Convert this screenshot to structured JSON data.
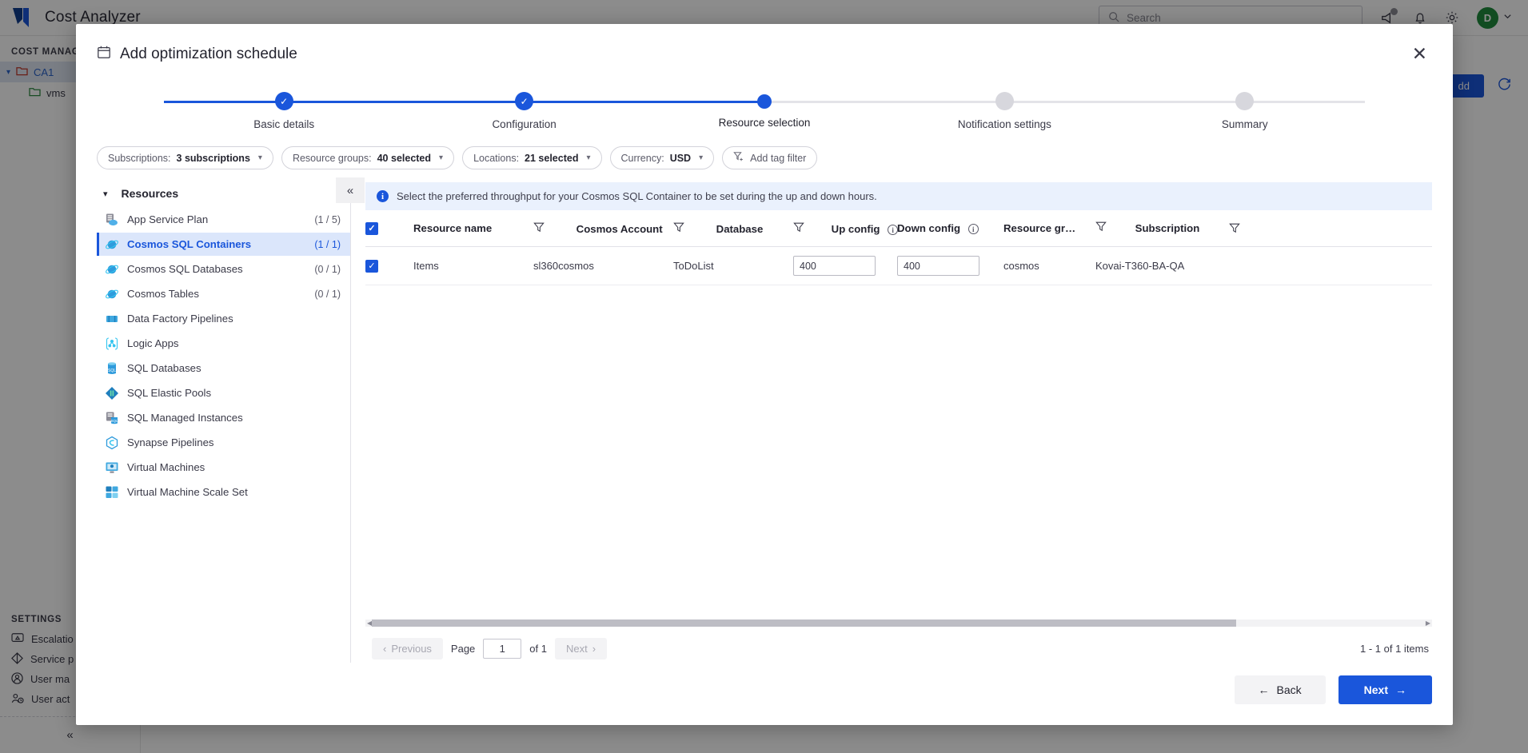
{
  "app": {
    "title": "Cost Analyzer",
    "logo_icon": "azure-logo-icon",
    "search_placeholder": "Search",
    "icons": {
      "search": "search-icon",
      "announcement": "megaphone-icon",
      "notifications": "bell-icon",
      "settings": "gear-icon",
      "avatar_initial": "D",
      "avatar_chevron": "chevron-down-icon"
    },
    "accent_color": "#1a56db",
    "avatar_color": "#1f8a3c"
  },
  "left_nav": {
    "section_title": "COST MANAGE",
    "tree": [
      {
        "label": "CA1",
        "selected": true,
        "folder_color": "#c03a2b",
        "expanded": true
      },
      {
        "label": "vms",
        "selected": false,
        "folder_color": "#2f8a43",
        "child": true
      }
    ],
    "settings_title": "SETTINGS",
    "settings_items": [
      {
        "label": "Escalatio",
        "icon": "escalation-icon"
      },
      {
        "label": "Service p",
        "icon": "diamond-icon"
      },
      {
        "label": "User ma",
        "icon": "user-circle-icon"
      },
      {
        "label": "User act",
        "icon": "user-activity-icon"
      }
    ],
    "collapse_icon": "chevron-double-left-icon"
  },
  "background_page": {
    "add_button": "dd",
    "refresh_icon": "refresh-icon"
  },
  "modal": {
    "title": "Add optimization schedule",
    "title_icon": "calendar-icon",
    "close_icon": "close-icon",
    "stepper": {
      "steps": [
        {
          "label": "Basic details",
          "state": "done"
        },
        {
          "label": "Configuration",
          "state": "done"
        },
        {
          "label": "Resource selection",
          "state": "active"
        },
        {
          "label": "Notification settings",
          "state": "pending"
        },
        {
          "label": "Summary",
          "state": "pending"
        }
      ]
    },
    "filters": [
      {
        "name": "subscriptions",
        "label": "Subscriptions:",
        "value": "3 subscriptions",
        "has_chevron": true
      },
      {
        "name": "resource-groups",
        "label": "Resource groups:",
        "value": "40 selected",
        "has_chevron": true
      },
      {
        "name": "locations",
        "label": "Locations:",
        "value": "21 selected",
        "has_chevron": true
      },
      {
        "name": "currency",
        "label": "Currency:",
        "value": "USD",
        "has_chevron": true
      },
      {
        "name": "add-tag-filter",
        "label": "",
        "value": "Add tag filter",
        "has_chevron": false,
        "icon": "filter-plus-icon"
      }
    ],
    "resources_panel": {
      "header": "Resources",
      "collapse_icon": "chevron-double-left-icon",
      "items": [
        {
          "label": "App Service Plan",
          "count": "(1 / 5)",
          "icon": "app-service-plan-icon",
          "selected": false
        },
        {
          "label": "Cosmos SQL Containers",
          "count": "(1 / 1)",
          "icon": "cosmos-db-icon",
          "selected": true
        },
        {
          "label": "Cosmos SQL Databases",
          "count": "(0 / 1)",
          "icon": "cosmos-db-icon",
          "selected": false
        },
        {
          "label": "Cosmos Tables",
          "count": "(0 / 1)",
          "icon": "cosmos-db-icon",
          "selected": false
        },
        {
          "label": "Data Factory Pipelines",
          "count": "",
          "icon": "data-factory-icon",
          "selected": false
        },
        {
          "label": "Logic Apps",
          "count": "",
          "icon": "logic-apps-icon",
          "selected": false
        },
        {
          "label": "SQL Databases",
          "count": "",
          "icon": "sql-database-icon",
          "selected": false
        },
        {
          "label": "SQL Elastic Pools",
          "count": "",
          "icon": "sql-elastic-pool-icon",
          "selected": false
        },
        {
          "label": "SQL Managed Instances",
          "count": "",
          "icon": "sql-managed-instance-icon",
          "selected": false
        },
        {
          "label": "Synapse Pipelines",
          "count": "",
          "icon": "synapse-icon",
          "selected": false
        },
        {
          "label": "Virtual Machines",
          "count": "",
          "icon": "virtual-machine-icon",
          "selected": false
        },
        {
          "label": "Virtual Machine Scale Set",
          "count": "",
          "icon": "vmss-icon",
          "selected": false
        }
      ]
    },
    "info_bar": {
      "icon": "info-icon",
      "text": "Select the preferred throughput for your Cosmos SQL Container to be set during the up and down hours."
    },
    "table": {
      "select_all_checked": true,
      "columns": [
        {
          "label": "Resource name",
          "filterable": true,
          "info": false
        },
        {
          "label": "Cosmos Account",
          "filterable": true,
          "info": false
        },
        {
          "label": "Database",
          "filterable": true,
          "info": false
        },
        {
          "label": "Up config",
          "filterable": false,
          "info": true
        },
        {
          "label": "Down config",
          "filterable": false,
          "info": true
        },
        {
          "label": "Resource gr…",
          "filterable": true,
          "info": false
        },
        {
          "label": "Subscription",
          "filterable": true,
          "info": false
        }
      ],
      "rows": [
        {
          "checked": true,
          "resource_name": "Items",
          "cosmos_account": "sl360cosmos",
          "database": "ToDoList",
          "up_config": "400",
          "down_config": "400",
          "resource_group": "cosmos",
          "subscription": "Kovai-T360-BA-QA"
        }
      ]
    },
    "pagination": {
      "previous_label": "Previous",
      "previous_icon": "chevron-left-icon",
      "page_label": "Page",
      "page_value": "1",
      "of_label": "of 1",
      "next_label": "Next",
      "next_icon": "chevron-right-icon",
      "item_count": "1 - 1 of 1 items"
    },
    "footer": {
      "back_label": "Back",
      "back_icon": "arrow-left-icon",
      "next_label": "Next",
      "next_icon": "arrow-right-icon"
    }
  }
}
